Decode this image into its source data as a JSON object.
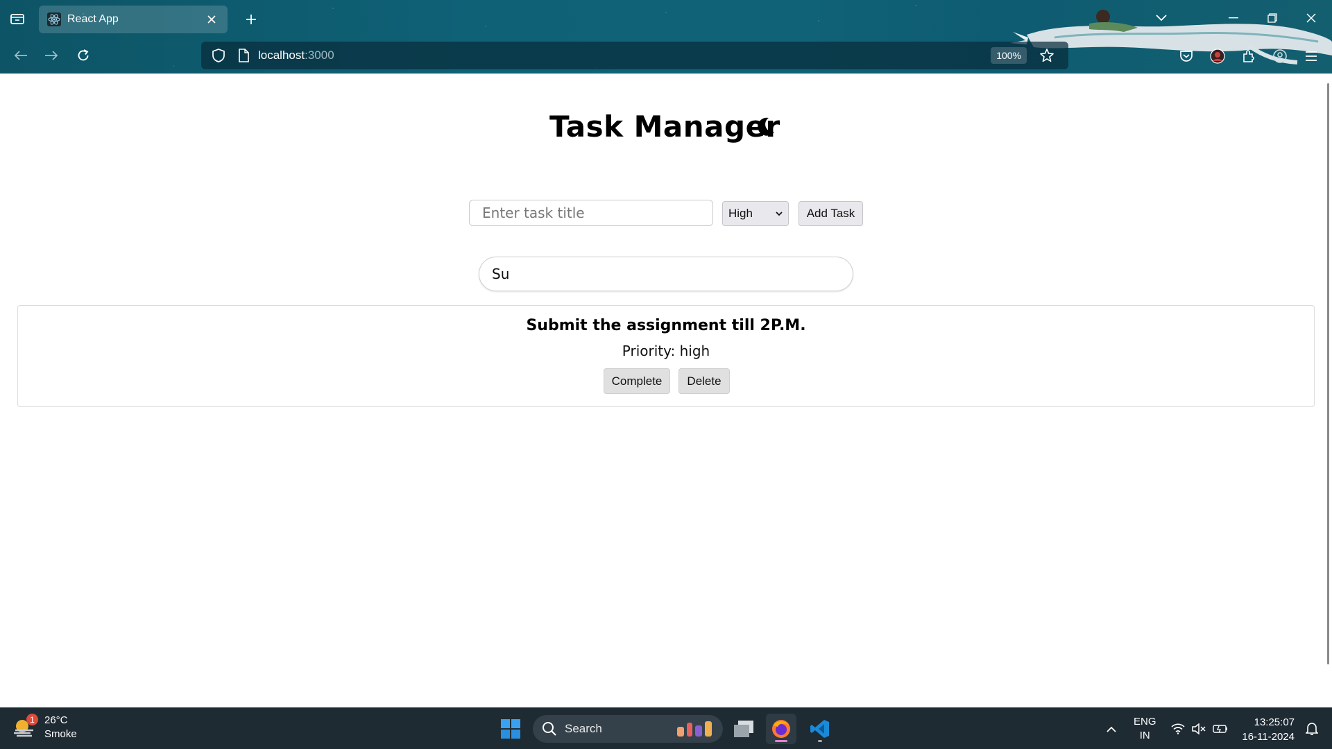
{
  "browser": {
    "tab_title": "React App",
    "url_host": "localhost",
    "url_port": ":3000",
    "zoom": "100%"
  },
  "app": {
    "title": "Task Manager",
    "task_input_placeholder": "Enter task title",
    "priority_selected": "High",
    "add_button": "Add Task",
    "search_value": "Su",
    "tasks": [
      {
        "title": "Submit the assignment till 2P.M.",
        "priority_text": "Priority: high",
        "complete_label": "Complete",
        "delete_label": "Delete"
      }
    ]
  },
  "taskbar": {
    "weather_temp": "26°C",
    "weather_desc": "Smoke",
    "weather_badge": "1",
    "search_label": "Search",
    "lang_line1": "ENG",
    "lang_line2": "IN",
    "time": "13:25:07",
    "date": "16-11-2024"
  },
  "icons": [
    "tab-list-icon",
    "react-icon",
    "close-icon",
    "plus-icon",
    "chevron-down-icon",
    "minimize-icon",
    "restore-icon",
    "back-icon",
    "forward-icon",
    "reload-icon",
    "shield-icon",
    "page-icon",
    "star-icon",
    "pocket-icon",
    "extension-icon",
    "account-icon",
    "menu-icon",
    "moon-icon",
    "windows-start-icon",
    "search-icon",
    "file-explorer-icon",
    "firefox-icon",
    "vscode-icon",
    "wifi-icon",
    "speaker-muted-icon",
    "battery-icon",
    "notification-icon"
  ],
  "colors": {
    "chrome_bg": "#0f6176",
    "taskbar_bg": "#1f2b33",
    "button_bg": "#e9e9ed"
  }
}
